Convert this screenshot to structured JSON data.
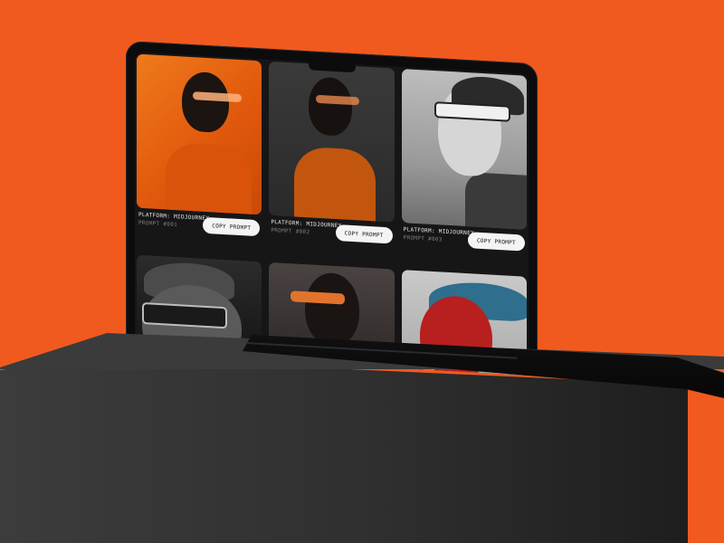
{
  "cards": [
    {
      "platform": "PLATFORM: MIDJOURNEY",
      "prompt": "PROMPT #001",
      "button": "COPY PROMPT"
    },
    {
      "platform": "PLATFORM: MIDJOURNEY",
      "prompt": "PROMPT #002",
      "button": "COPY PROMPT"
    },
    {
      "platform": "PLATFORM: MIDJOURNEY",
      "prompt": "PROMPT #003",
      "button": "COPY PROMPT"
    }
  ],
  "colors": {
    "background": "#f15a1f",
    "screen": "#161617",
    "button": "#f4f4f4"
  }
}
